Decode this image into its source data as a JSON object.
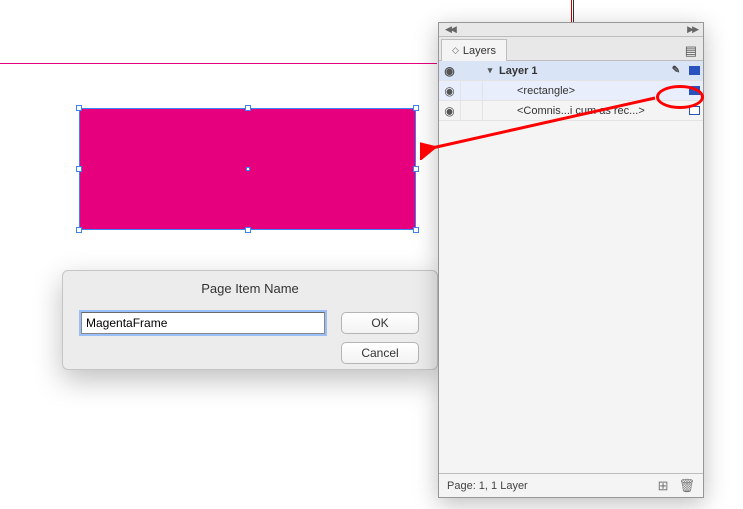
{
  "canvas": {
    "selected_shape": "rectangle"
  },
  "dialog": {
    "title": "Page Item Name",
    "input_value": "MagentaFrame",
    "ok_label": "OK",
    "cancel_label": "Cancel"
  },
  "layers_panel": {
    "tab_label": "Layers",
    "rows": [
      {
        "name": "Layer 1",
        "kind": "layer",
        "selected": true,
        "expanded": true,
        "swatch": "filled",
        "show_pen": true
      },
      {
        "name": "<rectangle>",
        "kind": "item",
        "selected": true,
        "swatch": "filled"
      },
      {
        "name": "<Comnis...i cum as rec...>",
        "kind": "item",
        "selected": false,
        "swatch": "hollow"
      }
    ],
    "footer_status": "Page: 1, 1 Layer"
  },
  "icons": {
    "eye": "◉",
    "pen": "✎",
    "menu": "▤",
    "sort": "◇",
    "new": "⊞",
    "trash": "🗑",
    "collapse_left": "◀◀",
    "collapse_right": "▶▶",
    "disclosure_open": "▾"
  }
}
